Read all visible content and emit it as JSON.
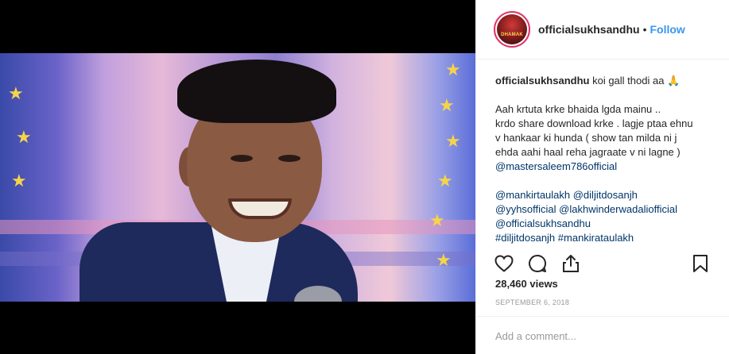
{
  "post": {
    "username": "officialsukhsandhu",
    "separator": "•",
    "follow_label": "Follow",
    "avatar_text": "DHAMAK",
    "caption_username": "officialsukhsandhu",
    "caption_first": "koi gall thodi aa",
    "caption_emoji": "🙏",
    "caption_lines": [
      "Aah krtuta krke bhaida lgda mainu ..",
      "krdo share download krke . lagje ptaa ehnu",
      "v hankaar ki hunda ( show tan milda ni j",
      "ehda aahi haal reha jagraate v ni lagne )"
    ],
    "mention_line1": "@mastersaleem786official",
    "tags": [
      "@mankirtaulakh @diljitdosanjh",
      "@yyhsofficial @lakhwinderwadaliofficial",
      "@officialsukhsandhu",
      "#diljitdosanjh #mankirataulakh"
    ],
    "views": "28,460 views",
    "date": "SEPTEMBER 6, 2018",
    "comment_placeholder": "Add a comment..."
  },
  "icons": [
    "heart-icon",
    "comment-icon",
    "share-icon",
    "bookmark-icon"
  ],
  "colors": {
    "follow": "#3897f0",
    "mention": "#003569",
    "muted": "#999999",
    "text": "#262626"
  }
}
